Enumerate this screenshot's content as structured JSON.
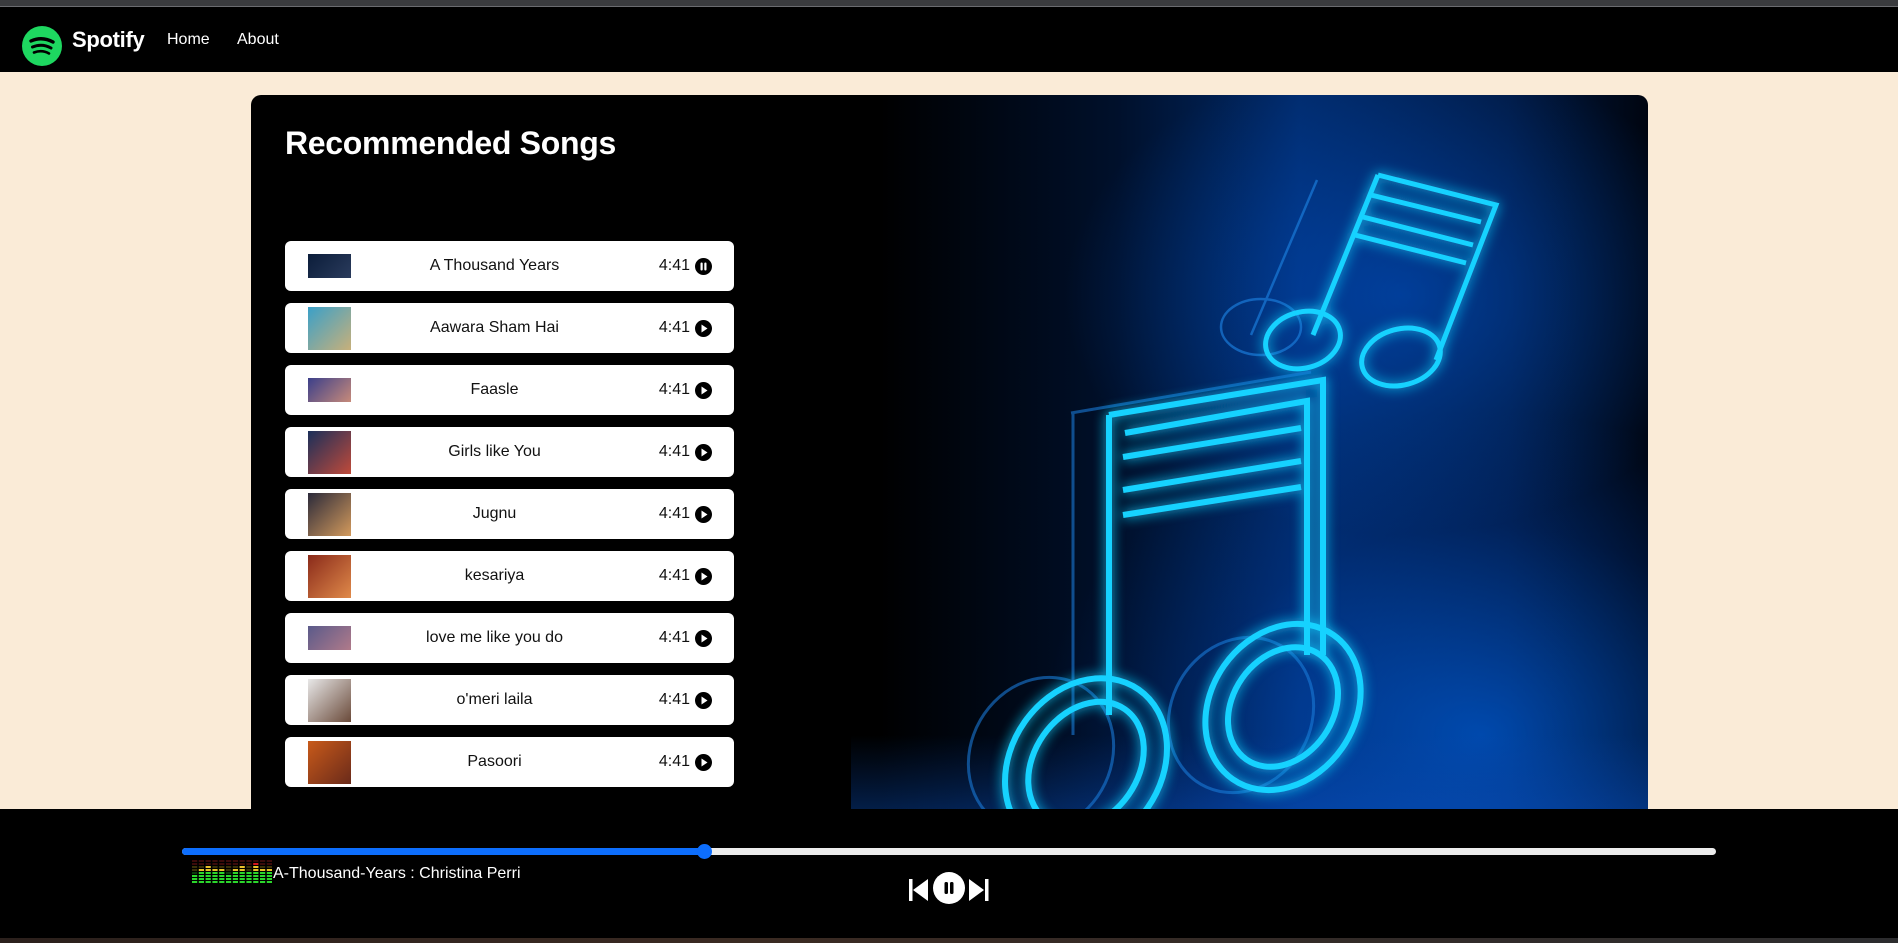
{
  "nav": {
    "brand": "Spotify",
    "links": [
      {
        "label": "Home"
      },
      {
        "label": "About"
      }
    ],
    "brand_color": "#1ed760"
  },
  "main": {
    "title": "Recommended Songs",
    "songs": [
      {
        "title": "A Thousand Years",
        "duration": "4:41",
        "state": "pause-icon",
        "cover_colors": [
          "#0b1d3a",
          "#2a3b5c"
        ],
        "cover_shape": "wide"
      },
      {
        "title": "Aawara Sham Hai",
        "duration": "4:41",
        "state": "play-icon",
        "cover_colors": [
          "#3aa0c8",
          "#c8b07a"
        ],
        "cover_shape": "square"
      },
      {
        "title": "Faasle",
        "duration": "4:41",
        "state": "play-icon",
        "cover_colors": [
          "#3b3f8a",
          "#c78a7a"
        ],
        "cover_shape": "wide"
      },
      {
        "title": "Girls like You",
        "duration": "4:41",
        "state": "play-icon",
        "cover_colors": [
          "#1a2f5a",
          "#c04a3a"
        ],
        "cover_shape": "square"
      },
      {
        "title": "Jugnu",
        "duration": "4:41",
        "state": "play-icon",
        "cover_colors": [
          "#2b2a3a",
          "#d39a5c"
        ],
        "cover_shape": "square"
      },
      {
        "title": "kesariya",
        "duration": "4:41",
        "state": "play-icon",
        "cover_colors": [
          "#8a2a1a",
          "#e08a4a"
        ],
        "cover_shape": "square"
      },
      {
        "title": "love me like you do",
        "duration": "4:41",
        "state": "play-icon",
        "cover_colors": [
          "#5a5a8a",
          "#b07a8a"
        ],
        "cover_shape": "wide"
      },
      {
        "title": "o'meri laila",
        "duration": "4:41",
        "state": "play-icon",
        "cover_colors": [
          "#e8e8e8",
          "#6a4a3a"
        ],
        "cover_shape": "square"
      },
      {
        "title": "Pasoori",
        "duration": "4:41",
        "state": "play-icon",
        "cover_colors": [
          "#c85a1a",
          "#6a2a1a"
        ],
        "cover_shape": "square"
      }
    ]
  },
  "player": {
    "now_playing": "A-Thousand-Years : Christina Perri",
    "progress_percent": 34,
    "accent_color": "#0d6efd",
    "controls": [
      {
        "name": "previous-icon"
      },
      {
        "name": "pause-icon"
      },
      {
        "name": "next-icon"
      }
    ]
  }
}
